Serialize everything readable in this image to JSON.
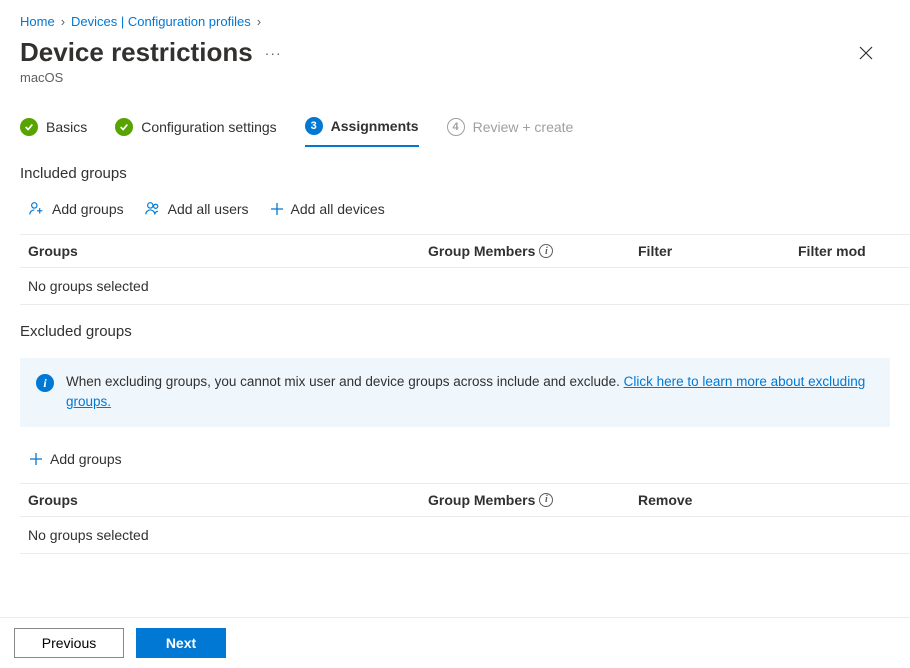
{
  "breadcrumb": {
    "home": "Home",
    "devices": "Devices | Configuration profiles"
  },
  "page": {
    "title": "Device restrictions",
    "subtitle": "macOS"
  },
  "stepper": {
    "step1": "Basics",
    "step2": "Configuration settings",
    "step3_num": "3",
    "step3": "Assignments",
    "step4_num": "4",
    "step4": "Review + create"
  },
  "included": {
    "heading": "Included groups",
    "add_groups": "Add groups",
    "add_all_users": "Add all users",
    "add_all_devices": "Add all devices",
    "cols": {
      "groups": "Groups",
      "members": "Group Members",
      "filter": "Filter",
      "filter_mode": "Filter mod"
    },
    "empty": "No groups selected"
  },
  "excluded": {
    "heading": "Excluded groups",
    "info_text": "When excluding groups, you cannot mix user and device groups across include and exclude. ",
    "info_link": "Click here to learn more about excluding groups.",
    "add_groups": "Add groups",
    "cols": {
      "groups": "Groups",
      "members": "Group Members",
      "remove": "Remove"
    },
    "empty": "No groups selected"
  },
  "footer": {
    "previous": "Previous",
    "next": "Next"
  }
}
